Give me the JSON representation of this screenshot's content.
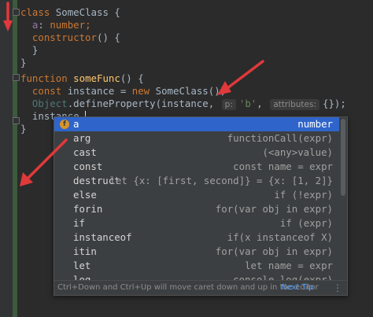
{
  "code": {
    "line1": {
      "kw": "class",
      "name": "SomeClass",
      "rest": " {"
    },
    "line2": {
      "field": "a",
      "sep": ": ",
      "type": "number",
      "end": ";"
    },
    "line3": {
      "kw": "constructor",
      "rest": "() {"
    },
    "line4": "}",
    "line5": "}",
    "line6": {
      "kw": "function",
      "fn": "someFunc",
      "rest": "() {"
    },
    "line7": {
      "kw1": "const",
      "var": " instance = ",
      "kw2": "new",
      "rest": " SomeClass();"
    },
    "line8": {
      "obj": "Object",
      "method": ".defineProperty(instance,",
      "hint_p": "p:",
      "str": "'b'",
      "comma": ",",
      "hint_attr": "attributes:",
      "end": "{});"
    },
    "line9": "instance.",
    "line10": "}"
  },
  "completion": {
    "items": [
      {
        "name": "a",
        "tail": "number",
        "selected": true,
        "icon": "field-icon",
        "icon_glyph": "f"
      },
      {
        "name": "arg",
        "tail": "functionCall(expr)"
      },
      {
        "name": "cast",
        "tail": "(<any>value)"
      },
      {
        "name": "const",
        "tail": "const name = expr"
      },
      {
        "name": "destruct",
        "tail": "let {x: [first, second]} = {x: [1, 2]}"
      },
      {
        "name": "else",
        "tail": "if (!expr)"
      },
      {
        "name": "forin",
        "tail": "for(var obj in expr)"
      },
      {
        "name": "if",
        "tail": "if (expr)"
      },
      {
        "name": "instanceof",
        "tail": "if(x instanceof X)"
      },
      {
        "name": "itin",
        "tail": "for(var obj in expr)"
      },
      {
        "name": "let",
        "tail": "let name = expr"
      },
      {
        "name": "log",
        "tail": "console.log(expr)"
      }
    ],
    "footer": {
      "tip": "Ctrl+Down and Ctrl+Up will move caret down and up in the editor",
      "next_tip": "Next Tip",
      "more": "⋮"
    }
  },
  "colors": {
    "background": "#2b2b2b",
    "selection": "#2f65ca",
    "arrow": "#e0393a",
    "keyword": "#cc7832"
  }
}
